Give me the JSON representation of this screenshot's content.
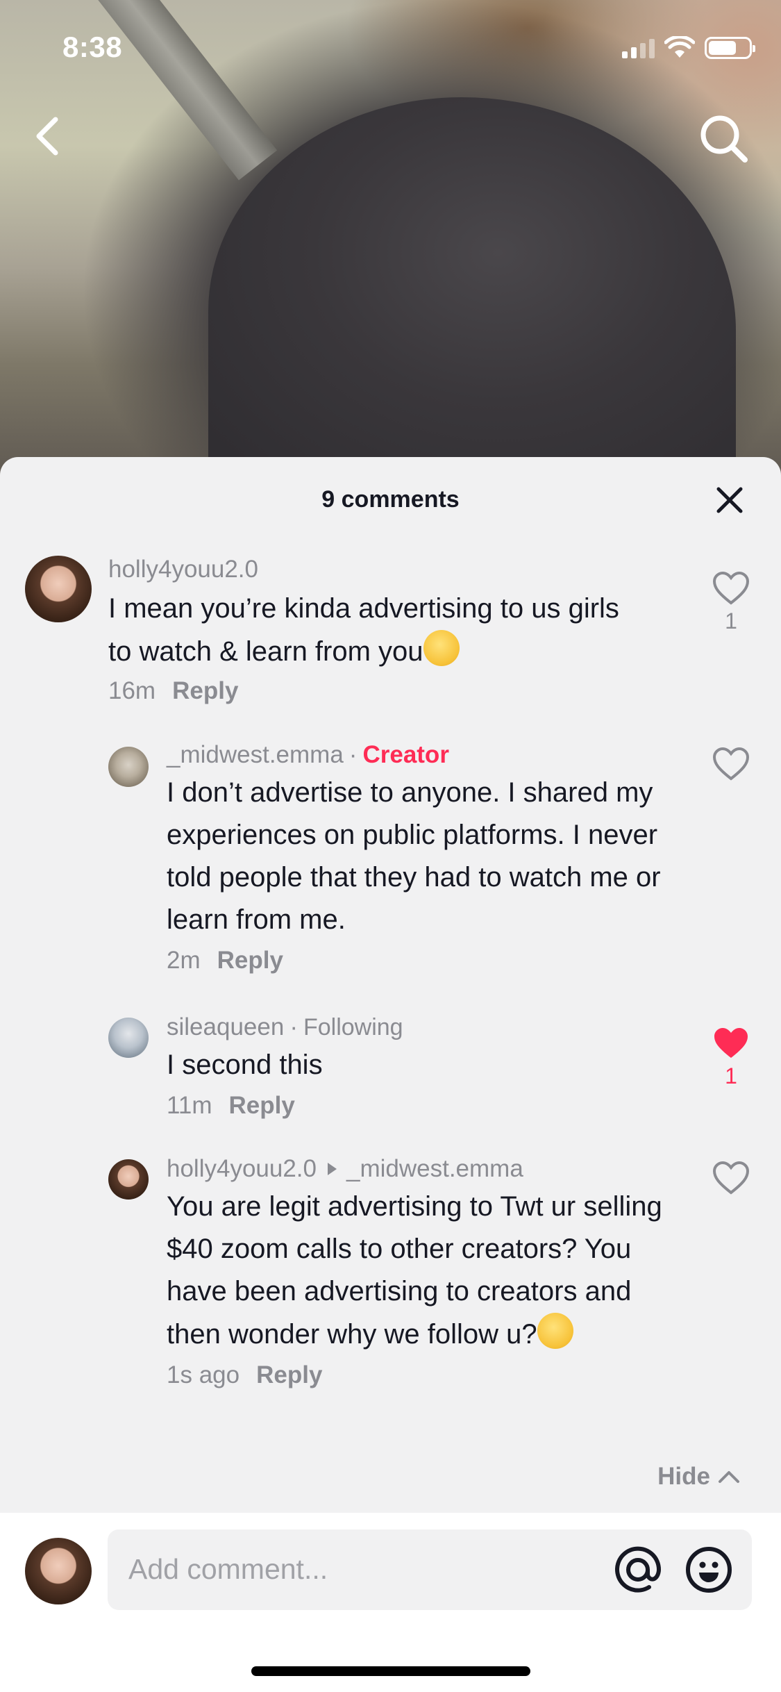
{
  "status_bar": {
    "time": "8:38"
  },
  "sheet": {
    "title": "9 comments"
  },
  "comments": [
    {
      "username": "holly4youu2.0",
      "text_before_emoji": "I mean you’re kinda advertising to us girls to watch & learn from you",
      "emoji": "sweat-smile-emoji",
      "time": "16m",
      "reply_label": "Reply",
      "likes": "1",
      "liked": false
    },
    {
      "username": "_midwest.emma",
      "badge": "Creator",
      "text": "I don’t advertise to anyone. I shared my experiences on public platforms. I never told people that they had to watch me or learn from me.",
      "time": "2m",
      "reply_label": "Reply",
      "likes": "",
      "liked": false
    },
    {
      "username": "sileaqueen",
      "badge": "Following",
      "text": "I second this",
      "time": "11m",
      "reply_label": "Reply",
      "likes": "1",
      "liked": true
    },
    {
      "username": "holly4youu2.0",
      "reply_to": "_midwest.emma",
      "text_before_emoji": "You are legit advertising to Twt ur selling $40 zoom calls to other creators? You have been advertising to creators and then wonder why we follow u?",
      "emoji": "tears-of-joy-emoji",
      "time": "1s ago",
      "reply_label": "Reply",
      "likes": "",
      "liked": false
    }
  ],
  "hide_label": "Hide",
  "compose": {
    "placeholder": "Add comment..."
  },
  "colors": {
    "accent": "#fe2c55",
    "muted": "#8a8b91",
    "sheet_bg": "#f1f1f2"
  }
}
